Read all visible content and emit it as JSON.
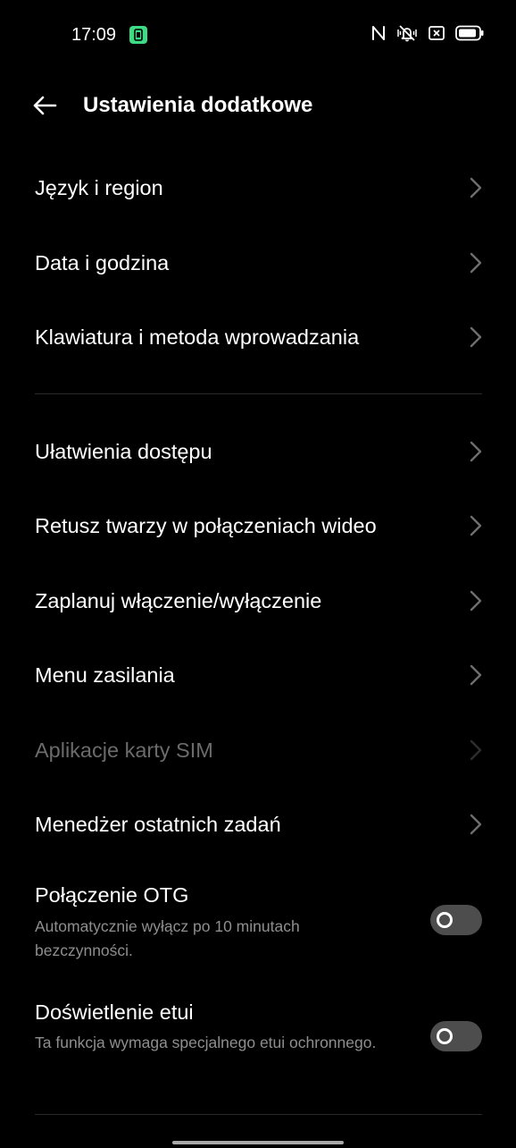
{
  "status_bar": {
    "time": "17:09",
    "icons": [
      "app-notification-icon",
      "nfc-icon",
      "vibrate-silent-icon",
      "sim-error-icon",
      "battery-icon"
    ]
  },
  "header": {
    "title": "Ustawienia dodatkowe",
    "back_icon": "arrow-left-icon"
  },
  "items": [
    {
      "label": "Język i region"
    },
    {
      "label": "Data i godzina"
    },
    {
      "label": "Klawiatura i metoda wprowadzania"
    },
    {
      "label": "Ułatwienia dostępu"
    },
    {
      "label": "Retusz twarzy w połączeniach wideo"
    },
    {
      "label": "Zaplanuj włączenie/wyłączenie"
    },
    {
      "label": "Menu zasilania"
    },
    {
      "label": "Aplikacje karty SIM",
      "disabled": true
    },
    {
      "label": "Menedżer ostatnich zadań"
    }
  ],
  "toggles": [
    {
      "label": "Połączenie OTG",
      "description": "Automatycznie wyłącz po 10 minutach bezczynności.",
      "enabled": false
    },
    {
      "label": "Doświetlenie etui",
      "description": "Ta funkcja wymaga specjalnego etui ochronnego.",
      "enabled": false
    }
  ],
  "colors": {
    "background": "#000000",
    "text": "#ffffff",
    "secondary_text": "#8e8e8e",
    "disabled_text": "#6b6b6b",
    "toggle_off": "#4d4d4d",
    "app_icon": "#3ddc84"
  }
}
